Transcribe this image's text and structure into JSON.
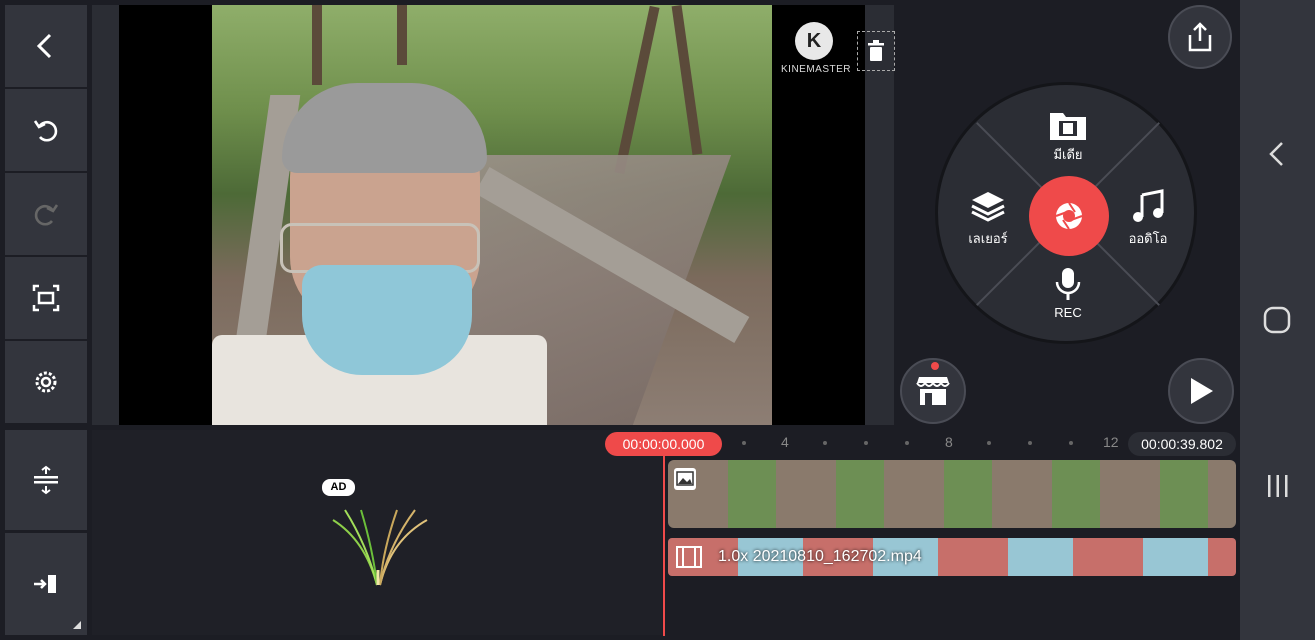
{
  "left_toolbar": {
    "back": "back-arrow",
    "undo": "undo",
    "redo": "redo",
    "fullscreen": "fullscreen",
    "settings": "settings"
  },
  "preview": {
    "watermark_text": "KINEMASTER"
  },
  "wheel": {
    "media_label": "มีเดีย",
    "layer_label": "เลเยอร์",
    "audio_label": "ออดิโอ",
    "rec_label": "REC"
  },
  "timeline": {
    "current_time": "00:00:00.000",
    "total_time": "00:00:39.802",
    "ruler_labels": [
      "4",
      "8",
      "12"
    ],
    "clip_filename": "1.0x 20210810_162702.mp4",
    "ad_badge": "AD"
  },
  "colors": {
    "accent": "#ef4a4a",
    "panel": "#33353d",
    "background": "#1c1d24"
  }
}
